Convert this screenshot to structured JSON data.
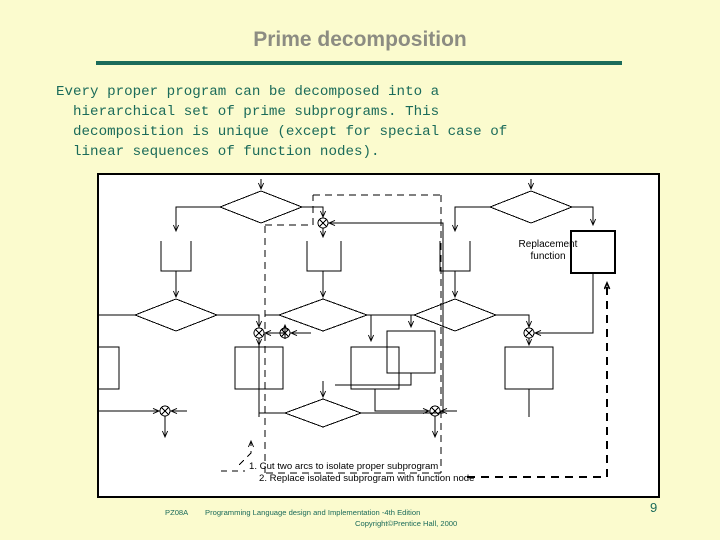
{
  "slide": {
    "title": "Prime decomposition",
    "body": "Every proper program can be decomposed into a\n  hierarchical set of prime subprograms. This\n  decomposition is unique (except for special case of\n  linear sequences of function nodes.",
    "page_number": "9",
    "accent_color": "#1b6b5a",
    "background_color": "#fbfbce",
    "title_color": "#8c8c82"
  },
  "body_lines": [
    "Every proper program can be decomposed into a",
    "  hierarchical set of prime subprograms. This",
    "  decomposition is unique (except for special case of",
    "  linear sequences of function nodes)."
  ],
  "diagram": {
    "name": "prime-decomposition-flowchart",
    "replacement_label_line1": "Replacement",
    "replacement_label_line2": "function",
    "steps": [
      "1. Cut two arcs to isolate proper subprogram",
      "2. Replace isolated subprogram with function node"
    ]
  },
  "footer": {
    "code": "PZ08A",
    "line1": "Programming Language design and Implementation -4th Edition",
    "line2": "Copyright©Prentice Hall, 2000"
  }
}
